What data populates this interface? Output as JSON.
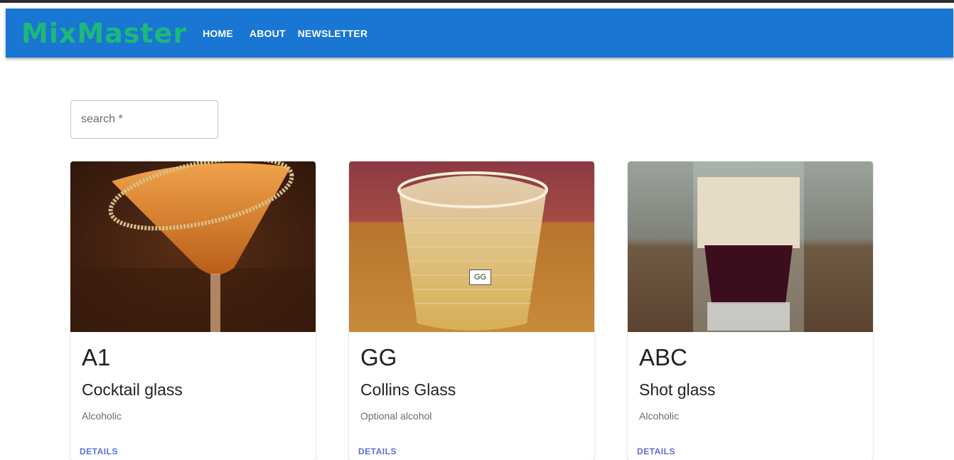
{
  "app": {
    "brand": "MixMaster",
    "nav": [
      "HOME",
      "ABOUT",
      "NEWSLETTER"
    ]
  },
  "search": {
    "placeholder": "search *"
  },
  "cards": [
    {
      "title": "A1",
      "glass": "Cocktail glass",
      "type": "Alcoholic",
      "action": "DETAILS"
    },
    {
      "title": "GG",
      "glass": "Collins Glass",
      "type": "Optional alcohol",
      "action": "DETAILS",
      "tooltip": "GG"
    },
    {
      "title": "ABC",
      "glass": "Shot glass",
      "type": "Alcoholic",
      "action": "DETAILS"
    }
  ]
}
